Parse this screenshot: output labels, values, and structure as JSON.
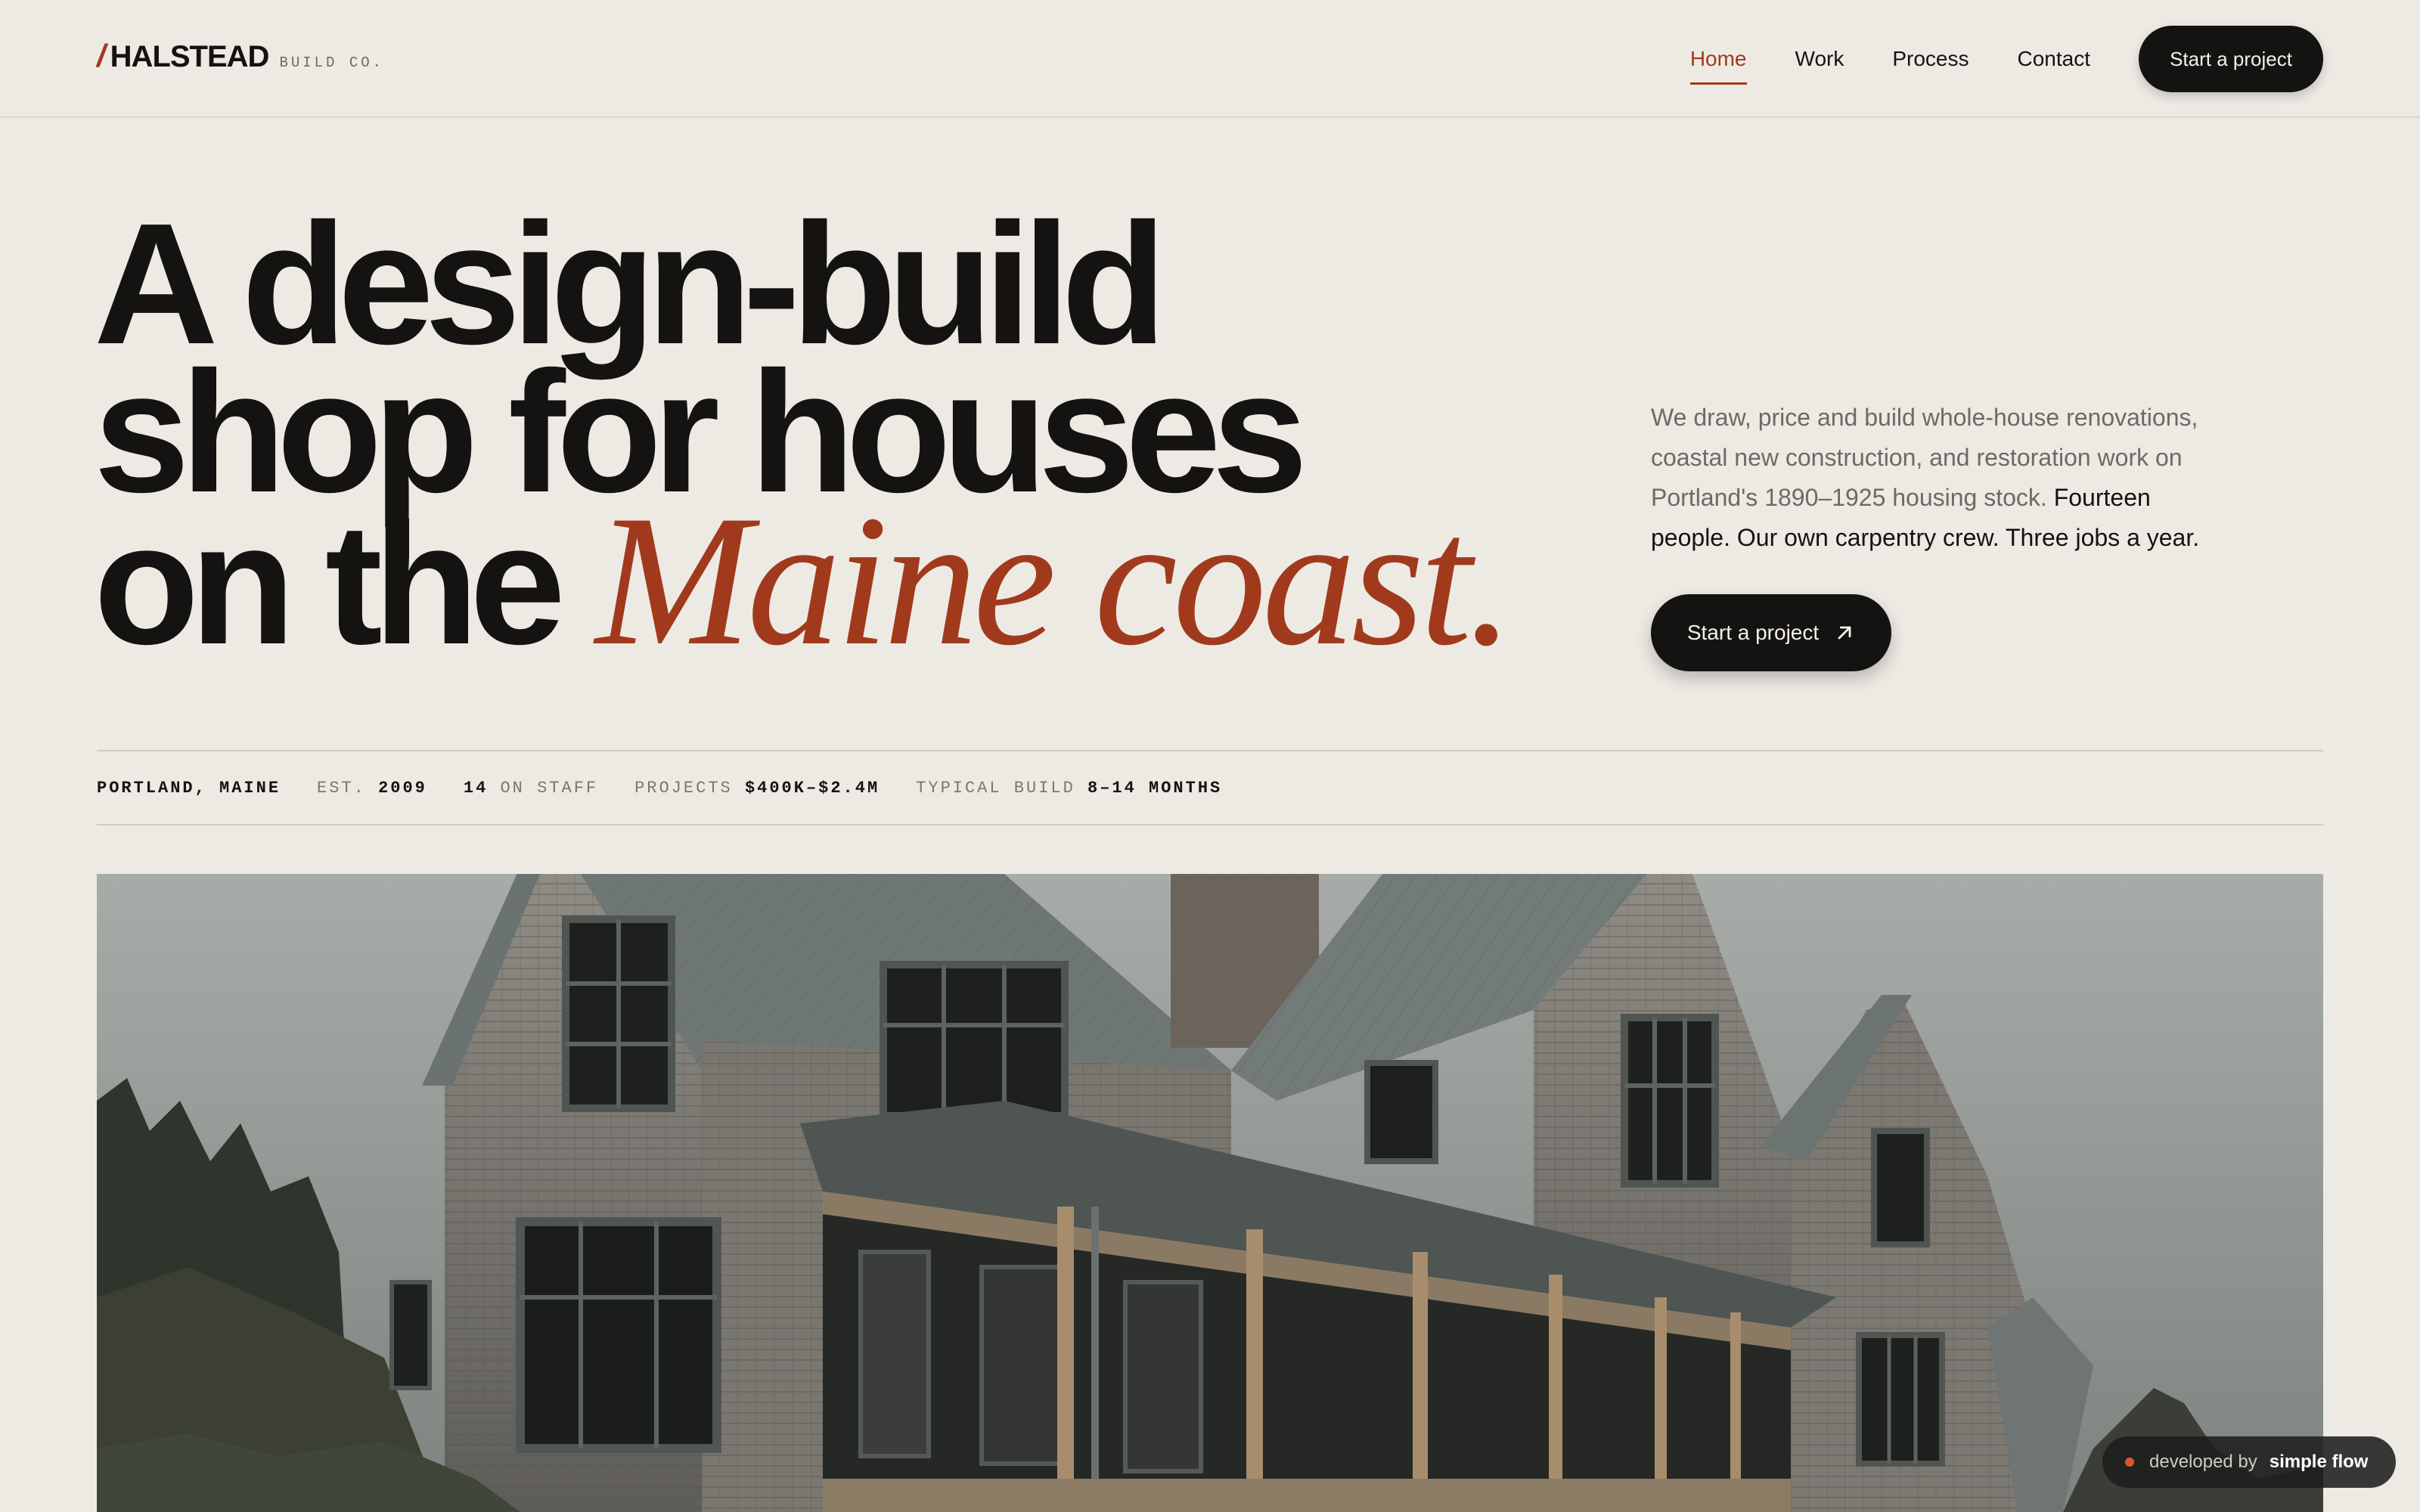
{
  "brand": {
    "slash": "/",
    "name": "HALSTEAD",
    "sub": "BUILD CO."
  },
  "nav": {
    "items": [
      {
        "label": "Home",
        "active": true
      },
      {
        "label": "Work",
        "active": false
      },
      {
        "label": "Process",
        "active": false
      },
      {
        "label": "Contact",
        "active": false
      }
    ],
    "cta_label": "Start a project"
  },
  "hero": {
    "headline_line1": "A design-build",
    "headline_line2": "shop for houses",
    "headline_line3_plain": "on the",
    "headline_line3_accent": "Maine coast.",
    "intro_muted": "We draw, price and build whole-house renovations, coastal new construction, and restoration work on Portland's 1890–1925 housing stock.",
    "intro_strong": "Fourteen people. Our own carpentry crew. Three jobs a year.",
    "cta_label": "Start a project",
    "cta_icon": "arrow-up-right-icon"
  },
  "stats": [
    {
      "label": "",
      "value": "PORTLAND, MAINE"
    },
    {
      "label": "EST.",
      "value": "2009"
    },
    {
      "value": "14",
      "label": "ON STAFF"
    },
    {
      "label": "PROJECTS",
      "value": "$400K–$2.4M"
    },
    {
      "label": "TYPICAL BUILD",
      "value": "8–14 MONTHS"
    }
  ],
  "image": {
    "subject": "shingle-style coastal house with metal roof and porch"
  },
  "badge": {
    "label": "developed by",
    "name": "simple flow"
  },
  "colors": {
    "accent": "#a13a1d",
    "ink": "#141311",
    "background": "#edeae4"
  }
}
